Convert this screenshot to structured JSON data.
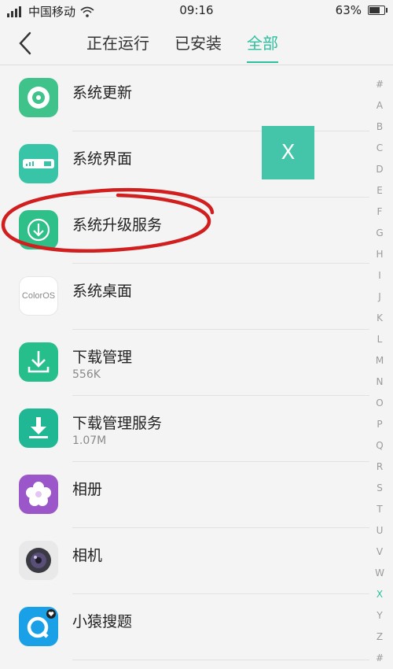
{
  "statusbar": {
    "carrier": "中国移动",
    "time": "09:16",
    "battery": "63%",
    "battery_level": 0.63
  },
  "nav": {
    "tabs": [
      {
        "label": "正在运行"
      },
      {
        "label": "已安装"
      },
      {
        "label": "全部"
      }
    ],
    "active_tab": 2
  },
  "apps": [
    {
      "name": "系统更新",
      "size": ""
    },
    {
      "name": "系统界面",
      "size": ""
    },
    {
      "name": "系统升级服务",
      "size": ""
    },
    {
      "name": "系统桌面",
      "size": ""
    },
    {
      "name": "下载管理",
      "size": "556K"
    },
    {
      "name": "下载管理服务",
      "size": "1.07M"
    },
    {
      "name": "相册",
      "size": ""
    },
    {
      "name": "相机",
      "size": ""
    },
    {
      "name": "小猿搜题",
      "size": ""
    }
  ],
  "coloros_logo_text": "ColorOS",
  "overlay": {
    "close_label": "X"
  },
  "alphabet": [
    "#",
    "A",
    "B",
    "C",
    "D",
    "E",
    "F",
    "G",
    "H",
    "I",
    "J",
    "K",
    "L",
    "M",
    "N",
    "O",
    "P",
    "Q",
    "R",
    "S",
    "T",
    "U",
    "V",
    "W",
    "X",
    "Y",
    "Z",
    "#"
  ],
  "alphabet_highlight": "X",
  "colors": {
    "accent": "#2fbf9e",
    "annotation": "#d11f1f"
  }
}
